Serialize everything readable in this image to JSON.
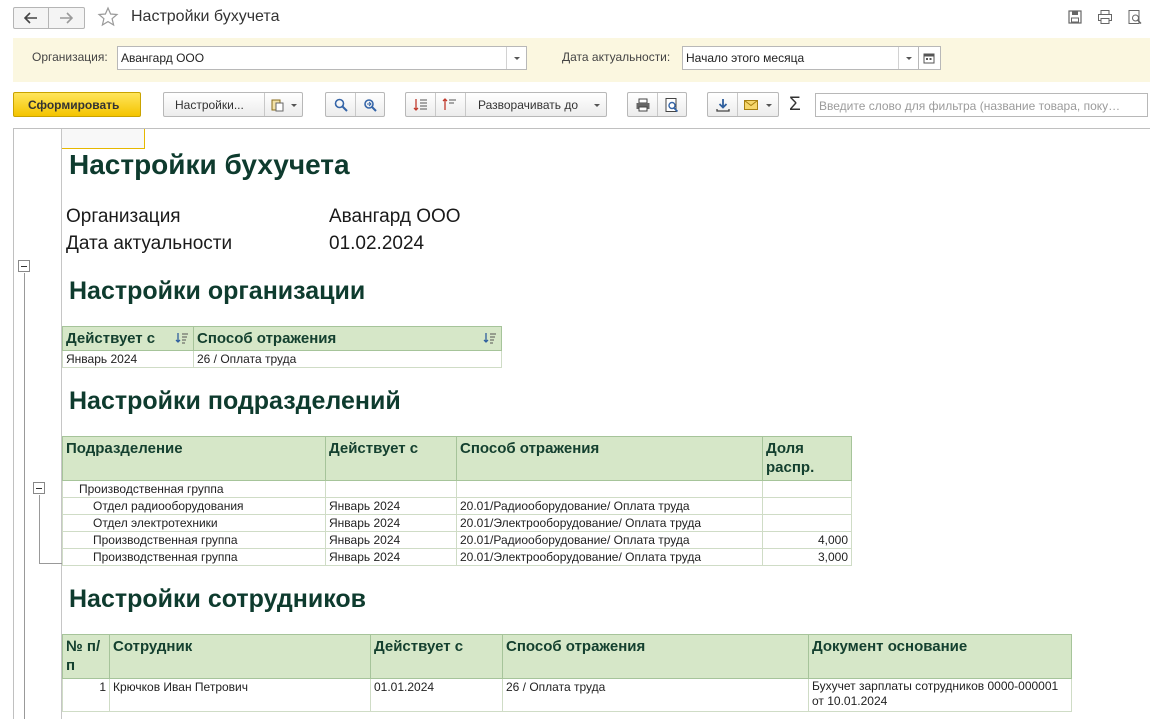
{
  "window": {
    "title": "Настройки бухучета"
  },
  "filters": {
    "org_label": "Организация:",
    "org_value": "Авангард ООО",
    "date_label": "Дата актуальности:",
    "date_value": "Начало этого месяца"
  },
  "toolbar": {
    "generate_label": "Сформировать",
    "settings_label": "Настройки...",
    "expand_label": "Разворачивать до",
    "search_placeholder": "Введите слово для фильтра (название товара, поку…",
    "sum_symbol": "Σ"
  },
  "report": {
    "title": "Настройки бухучета",
    "meta": [
      {
        "label": "Организация",
        "value": "Авангард ООО"
      },
      {
        "label": "Дата актуальности",
        "value": "01.02.2024"
      }
    ],
    "org_section": {
      "heading": "Настройки организации",
      "columns": [
        "Действует с",
        "Способ отражения"
      ],
      "rows": [
        [
          "Январь 2024",
          "26 / Оплата труда"
        ]
      ]
    },
    "dept_section": {
      "heading": "Настройки подразделений",
      "columns": [
        "Подразделение",
        "Действует с",
        "Способ отражения",
        "Доля распр."
      ],
      "rows": [
        [
          "Производственная группа",
          "",
          "",
          ""
        ],
        [
          "Отдел радиооборудования",
          "Январь 2024",
          "20.01/Радиооборудование/ Оплата труда",
          ""
        ],
        [
          "Отдел электротехники",
          "Январь 2024",
          "20.01/Электрооборудование/ Оплата труда",
          ""
        ],
        [
          "Производственная группа",
          "Январь 2024",
          "20.01/Радиооборудование/ Оплата труда",
          "4,000"
        ],
        [
          "Производственная группа",
          "Январь 2024",
          "20.01/Электрооборудование/ Оплата труда",
          "3,000"
        ]
      ]
    },
    "emp_section": {
      "heading": "Настройки сотрудников",
      "columns": [
        "№ п/п",
        "Сотрудник",
        "Действует с",
        "Способ отражения",
        "Документ основание"
      ],
      "rows": [
        [
          "1",
          "Крючков Иван Петрович",
          "01.01.2024",
          "26 / Оплата труда",
          "Бухучет зарплаты сотрудников 0000-000001 от 10.01.2024"
        ]
      ]
    }
  }
}
